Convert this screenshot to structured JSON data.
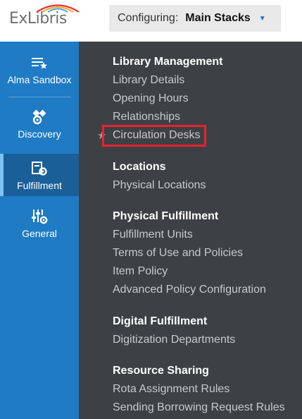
{
  "header": {
    "logo_text": "ExLibris",
    "configuring_label": "Configuring:",
    "configuring_value": "Main Stacks"
  },
  "sidebar": {
    "items": [
      {
        "label": "Alma Sandbox",
        "icon": "list-star-icon"
      },
      {
        "label": "Discovery",
        "icon": "satellite-gear-icon"
      },
      {
        "label": "Fulfillment",
        "icon": "gear-document-icon"
      },
      {
        "label": "General",
        "icon": "sliders-gear-icon"
      }
    ],
    "active": "Fulfillment"
  },
  "menu": {
    "sections": [
      {
        "title": "Library Management",
        "items": [
          "Library Details",
          "Opening Hours",
          "Relationships",
          "Circulation Desks"
        ]
      },
      {
        "title": "Locations",
        "items": [
          "Physical Locations"
        ]
      },
      {
        "title": "Physical Fulfillment",
        "items": [
          "Fulfillment Units",
          "Terms of Use and Policies",
          "Item Policy",
          "Advanced Policy Configuration"
        ]
      },
      {
        "title": "Digital Fulfillment",
        "items": [
          "Digitization Departments"
        ]
      },
      {
        "title": "Resource Sharing",
        "items": [
          "Rota Assignment Rules",
          "Sending Borrowing Request Rules"
        ]
      }
    ],
    "starred_item": "Circulation Desks"
  },
  "colors": {
    "sidebar_bg": "#1f7bc4",
    "menu_bg": "#3d4044",
    "highlight": "#e8232f"
  }
}
